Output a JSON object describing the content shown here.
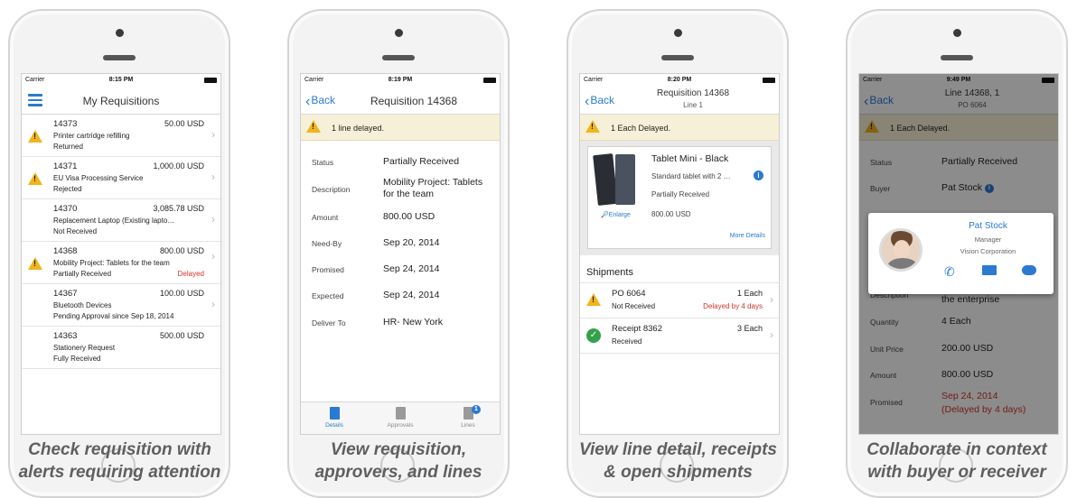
{
  "colors": {
    "accent": "#2a7ad2",
    "alert_bg": "#f7f0d8",
    "warning": "#f1b51b",
    "delayed": "#d0332b",
    "success": "#35a04a"
  },
  "phone1": {
    "status": {
      "carrier": "Carrier",
      "time": "8:15 PM"
    },
    "title": "My Requisitions",
    "requisitions": [
      {
        "number": "14373",
        "amount": "50.00 USD",
        "description": "Printer cartridge refilling",
        "status": "Returned",
        "flag": ""
      },
      {
        "number": "14371",
        "amount": "1,000.00 USD",
        "description": "EU Visa Processing Service",
        "status": "Rejected",
        "flag": ""
      },
      {
        "number": "14370",
        "amount": "3,085.78 USD",
        "description": "Replacement Laptop (Existing lapto…",
        "status": "Not Received",
        "flag": ""
      },
      {
        "number": "14368",
        "amount": "800.00 USD",
        "description": "Mobility Project: Tablets for the team",
        "status": "Partially Received",
        "flag": "Delayed"
      },
      {
        "number": "14367",
        "amount": "100.00 USD",
        "description": "Bluetooth Devices",
        "status": "Pending Approval since Sep 18, 2014",
        "flag": ""
      },
      {
        "number": "14363",
        "amount": "500.00 USD",
        "description": "Stationery Request",
        "status": "Fully Received",
        "flag": ""
      }
    ],
    "caption": [
      "Check requisition  with",
      "alerts requiring  attention"
    ]
  },
  "phone2": {
    "status": {
      "carrier": "Carrier",
      "time": "8:19 PM"
    },
    "back": "Back",
    "title": "Requisition 14368",
    "alert": "1 line delayed.",
    "fields": {
      "status_label": "Status",
      "status_value": "Partially Received",
      "description_label": "Description",
      "description_value": "Mobility Project: Tablets for the team",
      "amount_label": "Amount",
      "amount_value": "800.00 USD",
      "needby_label": "Need-By",
      "needby_value": "Sep 20, 2014",
      "promised_label": "Promised",
      "promised_value": "Sep 24, 2014",
      "expected_label": "Expected",
      "expected_value": "Sep 24, 2014",
      "deliver_label": "Deliver To",
      "deliver_value": "HR- New York"
    },
    "tabs": {
      "details": "Details",
      "approvals": "Approvals",
      "lines": "Lines",
      "lines_badge": "1"
    },
    "caption": [
      "View requisition,",
      "approvers, and lines"
    ]
  },
  "phone3": {
    "status": {
      "carrier": "Carrier",
      "time": "8:20 PM"
    },
    "back": "Back",
    "title": "Requisition 14368",
    "subtitle": "Line 1",
    "alert": "1 Each Delayed.",
    "item": {
      "name": "Tablet Mini - Black",
      "desc": "Standard tablet with 2 …",
      "status": "Partially Received",
      "amount": "800.00 USD",
      "enlarge": "Enlarge",
      "more": "More Details"
    },
    "shipments_title": "Shipments",
    "shipments": [
      {
        "title": "PO 6064",
        "qty": "1 Each",
        "status": "Not Received",
        "note": "Delayed by 4 days"
      },
      {
        "title": "Receipt 8362",
        "qty": "3 Each",
        "status": "Received",
        "note": ""
      }
    ],
    "caption": [
      "View line detail, receipts",
      "& open shipments"
    ]
  },
  "phone4": {
    "status": {
      "carrier": "Carrier",
      "time": "9:49 PM"
    },
    "back": "Back",
    "title": "Line 14368, 1",
    "subtitle": "PO 6064",
    "alert": "1 Each Delayed.",
    "fields": {
      "status_label": "Status",
      "status_value": "Partially Received",
      "buyer_label": "Buyer",
      "buyer_value": "Pat Stock",
      "description_label": "Description",
      "description_value": "Standard 7-inch tablet for the enterprise",
      "quantity_label": "Quantity",
      "quantity_value": "4 Each",
      "unitprice_label": "Unit Price",
      "unitprice_value": "200.00 USD",
      "amount_label": "Amount",
      "amount_value": "800.00 USD",
      "promised_label": "Promised",
      "promised_value": "Sep 24, 2014",
      "promised_note": "(Delayed by 4 days)"
    },
    "contact": {
      "name": "Pat Stock",
      "role": "Manager",
      "company": "Vision Corporation"
    },
    "caption": [
      "Collaborate in context",
      "with buyer or receiver"
    ]
  }
}
